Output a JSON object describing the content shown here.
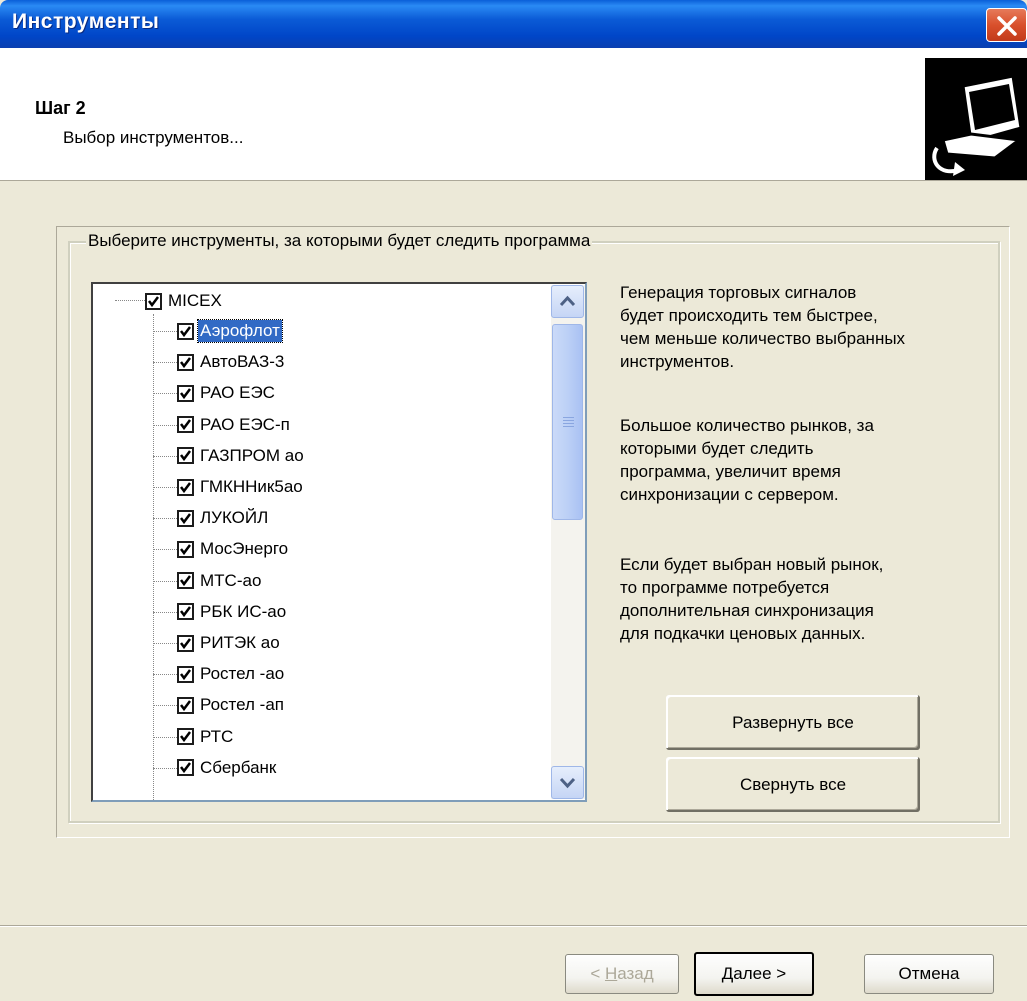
{
  "window": {
    "title": "Инструменты"
  },
  "header": {
    "step_title": "Шаг 2",
    "step_subtitle": "Выбор инструментов..."
  },
  "group": {
    "legend": "Выберите инструменты, за которыми будет следить программа"
  },
  "tree": {
    "root": "MICEX",
    "items": [
      {
        "label": "Аэрофлот",
        "checked": true,
        "selected": true
      },
      {
        "label": "АвтоВАЗ-3",
        "checked": true
      },
      {
        "label": "РАО ЕЭС",
        "checked": true
      },
      {
        "label": "РАО ЕЭС-п",
        "checked": true
      },
      {
        "label": "ГАЗПРОМ ао",
        "checked": true
      },
      {
        "label": "ГМКННик5ао",
        "checked": true
      },
      {
        "label": "ЛУКОЙЛ",
        "checked": true
      },
      {
        "label": "МосЭнерго",
        "checked": true
      },
      {
        "label": "МТС-ао",
        "checked": true
      },
      {
        "label": "РБК ИС-ао",
        "checked": true
      },
      {
        "label": "РИТЭК ао",
        "checked": true
      },
      {
        "label": "Ростел -ао",
        "checked": true
      },
      {
        "label": "Ростел -ап",
        "checked": true
      },
      {
        "label": "РТС",
        "checked": true
      },
      {
        "label": "Сбербанк",
        "checked": true
      }
    ]
  },
  "info": {
    "p1": [
      "Генерация торговых сигналов",
      "будет происходить тем быстрее,",
      "чем меньше количество выбранных",
      "инструментов."
    ],
    "p2": [
      "Большое количество рынков, за",
      "которыми будет следить",
      "программа, увеличит время",
      "синхронизации с сервером."
    ],
    "p3": [
      "Если будет выбран новый рынок,",
      "то программе потребуется",
      "дополнительная синхронизация",
      "для подкачки ценовых данных."
    ]
  },
  "buttons": {
    "expand_all": "Развернуть все",
    "collapse_all": "Свернуть все",
    "back_arrow": "< ",
    "back_hotkey": "Н",
    "back_rest": "азад",
    "next_hotkey": "Д",
    "next_rest": "алее >",
    "cancel": "Отмена"
  },
  "colors": {
    "titlebar": "#0054e3",
    "selection": "#316ac5",
    "face": "#ece9d8"
  }
}
